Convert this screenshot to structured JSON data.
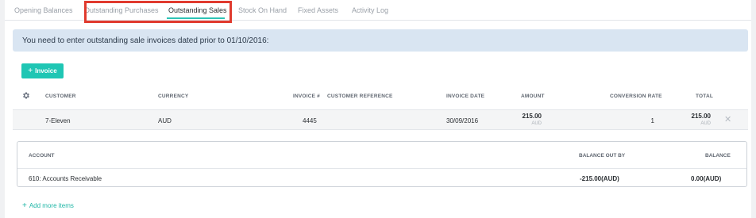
{
  "tabs": [
    {
      "label": "Opening Balances"
    },
    {
      "label": "Outstanding Purchases"
    },
    {
      "label": "Outstanding Sales"
    },
    {
      "label": "Stock On Hand"
    },
    {
      "label": "Fixed Assets"
    },
    {
      "label": "Activity Log"
    }
  ],
  "active_tab": "Outstanding Sales",
  "banner": {
    "text": "You need to enter outstanding sale invoices dated prior to 01/10/2016:"
  },
  "invoice_button": {
    "label": "Invoice",
    "icon": "plus-icon"
  },
  "table": {
    "headers": {
      "customer": "CUSTOMER",
      "currency": "CURRENCY",
      "invoice_no": "INVOICE #",
      "customer_ref": "CUSTOMER REFERENCE",
      "invoice_date": "INVOICE DATE",
      "amount": "AMOUNT",
      "conversion_rate": "CONVERSION RATE",
      "total": "TOTAL"
    },
    "rows": [
      {
        "customer": "7-Eleven",
        "currency": "AUD",
        "invoice_no": "4445",
        "customer_ref": "",
        "invoice_date": "30/09/2016",
        "amount": "215.00",
        "amount_currency": "AUD",
        "conversion_rate": "1",
        "total": "215.00",
        "total_currency": "AUD"
      }
    ]
  },
  "account_panel": {
    "headers": {
      "account": "ACCOUNT",
      "balance_out_by": "BALANCE OUT BY",
      "balance": "BALANCE"
    },
    "row": {
      "account": "610: Accounts Receivable",
      "balance_out_by": "-215.00(AUD)",
      "balance": "0.00(AUD)"
    }
  },
  "add_more": {
    "label": "Add more items"
  },
  "colors": {
    "accent": "#1fc6b4",
    "highlight_box": "#e03a2e",
    "banner_bg": "#d9e5f2"
  }
}
